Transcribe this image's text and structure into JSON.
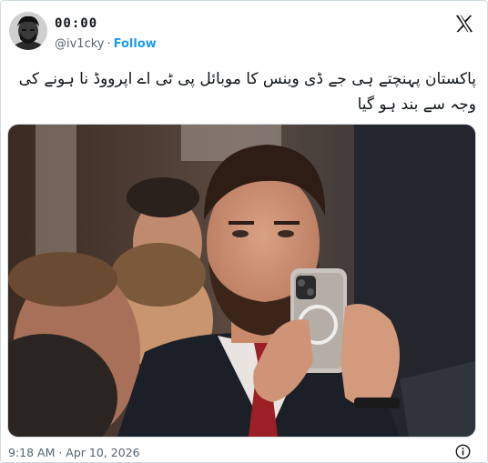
{
  "user": {
    "display_name": "00:00",
    "handle": "@iv1cky",
    "separator": "·",
    "follow_label": "Follow"
  },
  "tweet": {
    "text": "پاکستان پہنچتے ہی جے ڈی وینس کا موبائل پی ٹی اے اپرووڈ نا ہونے کی وجہ سے بند ہو گیا"
  },
  "footer": {
    "timestamp": "9:18 AM · Apr 10, 2026"
  },
  "icons": {
    "brand": "x-logo-icon",
    "info": "info-icon"
  },
  "colors": {
    "accent": "#1d9bf0",
    "muted": "#536471",
    "text": "#0f1419"
  }
}
